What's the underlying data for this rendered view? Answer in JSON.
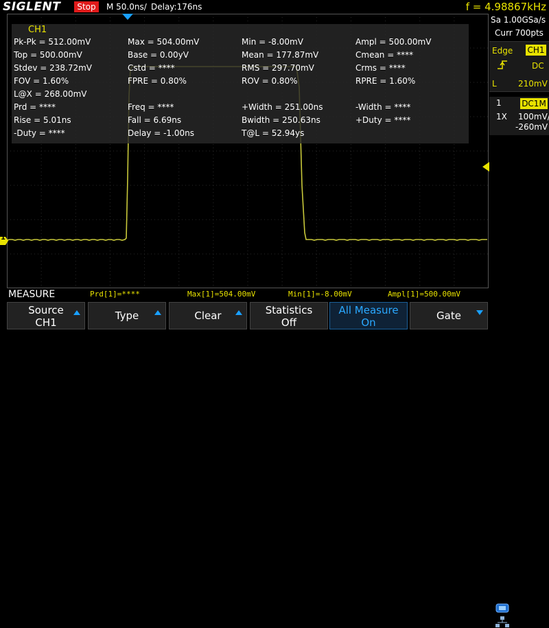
{
  "topbar": {
    "brand": "SIGLENT",
    "run_status": "Stop",
    "timebase": "M 50.0ns/",
    "delay": "Delay:176ns",
    "frequency": "f = 4.98867kHz"
  },
  "right_panel": {
    "sample_rate": "Sa 1.00GSa/s",
    "memory_depth": "Curr 700pts",
    "trigger": {
      "mode": "Edge",
      "source": "CH1",
      "slope_icon": "rising-edge-icon",
      "coupling": "DC",
      "level_label": "L",
      "level": "210mV"
    },
    "channel": {
      "number": "1",
      "coupling": "DC1M",
      "probe": "1X",
      "scale": "100mV/",
      "offset": "-260mV"
    }
  },
  "measure_panel": {
    "title": "CH1",
    "rows": [
      [
        "Pk-Pk = 512.00mV",
        "Max = 504.00mV",
        "Min = -8.00mV",
        "Ampl = 500.00mV"
      ],
      [
        "Top = 500.00mV",
        "Base = 0.00yV",
        "Mean = 177.87mV",
        "Cmean = ****"
      ],
      [
        "Stdev = 238.72mV",
        "Cstd = ****",
        "RMS = 297.70mV",
        "Crms = ****"
      ],
      [
        "FOV = 1.60%",
        "FPRE = 0.80%",
        "ROV = 0.80%",
        "RPRE = 1.60%"
      ],
      [
        "L@X = 268.00mV",
        "",
        "",
        ""
      ],
      [
        "Prd = ****",
        "Freq = ****",
        "+Width = 251.00ns",
        "-Width = ****"
      ],
      [
        "Rise = 5.01ns",
        "Fall = 6.69ns",
        "Bwidth = 250.63ns",
        "+Duty = ****"
      ],
      [
        "-Duty = ****",
        "Delay = -1.00ns",
        "T@L = 52.94ys",
        ""
      ]
    ]
  },
  "waveform": {
    "channel_marker": "1",
    "color": "#c8c83a"
  },
  "measure_strip": {
    "label": "MEASURE",
    "values": [
      "Prd[1]=****",
      "Max[1]=504.00mV",
      "Min[1]=-8.00mV",
      "Ampl[1]=500.00mV"
    ]
  },
  "softkeys": [
    {
      "line1": "Source",
      "line2": "CH1",
      "arrow": "up"
    },
    {
      "line1": "Type",
      "line2": "",
      "arrow": "up"
    },
    {
      "line1": "Clear",
      "line2": "",
      "arrow": "up"
    },
    {
      "line1": "Statistics",
      "line2": "Off",
      "arrow": ""
    },
    {
      "line1": "All Measure",
      "line2": "On",
      "arrow": ""
    },
    {
      "line1": "Gate",
      "line2": "",
      "arrow": "down"
    }
  ],
  "colors": {
    "accent_yellow": "#e8e200",
    "run_red": "#e01b1b",
    "active_blue": "#2aa8ff"
  }
}
